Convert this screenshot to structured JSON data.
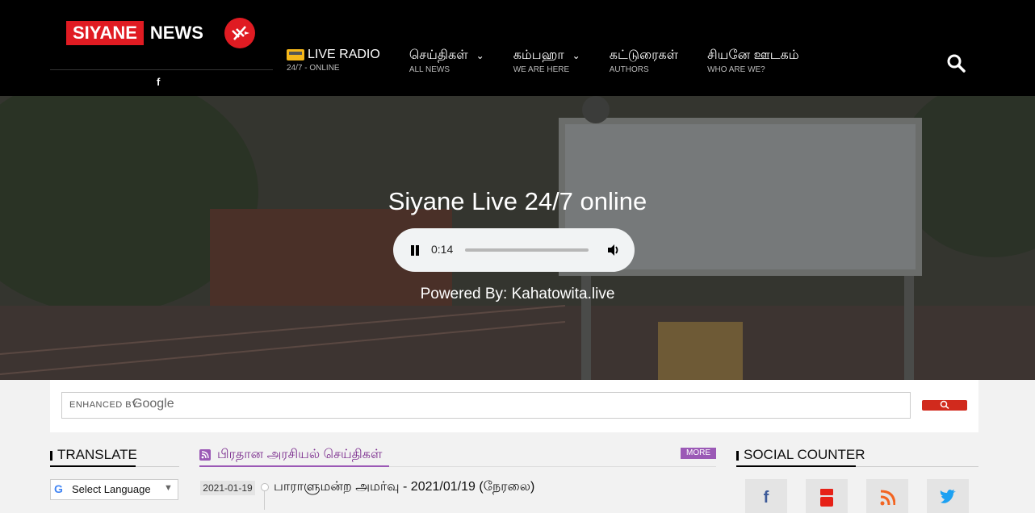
{
  "header": {
    "logo_left": "SIYANE",
    "logo_right": "NEWS",
    "facebook_link": "f",
    "nav": [
      {
        "label": "LIVE RADIO",
        "sub": "24/7 - ONLINE",
        "has_dropdown": false
      },
      {
        "label": "செய்திகள்",
        "sub": "ALL NEWS",
        "has_dropdown": true
      },
      {
        "label": "கம்பஹா",
        "sub": "WE ARE HERE",
        "has_dropdown": true
      },
      {
        "label": "கட்டுரைகள்",
        "sub": "AUTHORS",
        "has_dropdown": false
      },
      {
        "label": "சியனே ஊடகம்",
        "sub": "WHO ARE WE?",
        "has_dropdown": false
      }
    ],
    "search_icon": "search-icon"
  },
  "hero": {
    "title": "Siyane Live 24/7 online",
    "audio_time": "0:14",
    "powered_by": "Powered By: Kahatowita.live"
  },
  "search": {
    "enhanced_by": "ENHANCED BY",
    "google": "Google"
  },
  "translate": {
    "title": "TRANSLATE",
    "select_label": "Select Language",
    "g_letter": "G",
    "arrow": "▼"
  },
  "news": {
    "title": "பிரதான அரசியல் செய்திகள்",
    "more": "MORE",
    "items": [
      {
        "date": "2021-01-19",
        "headline": "பாராளுமன்ற அமர்வு - 2021/01/19 (நேரலை)"
      }
    ]
  },
  "social": {
    "title": "SOCIAL COUNTER",
    "networks": [
      {
        "name": "facebook-icon",
        "glyph": "f",
        "color": "#3b5998"
      },
      {
        "name": "youtube-icon",
        "glyph": "You",
        "color": "#e62117"
      },
      {
        "name": "rss-icon",
        "glyph": "rss",
        "color": "#f26522"
      },
      {
        "name": "twitter-icon",
        "glyph": "t",
        "color": "#1da1f2"
      }
    ]
  },
  "colors": {
    "brand_red": "#e01b22",
    "purple": "#9b59b6",
    "header_bg": "#000000"
  }
}
